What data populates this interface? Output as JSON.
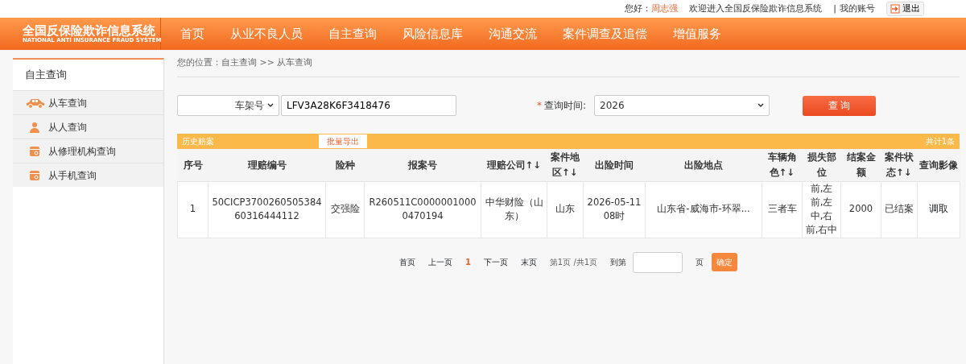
{
  "top_bar": {
    "greeting": "您好：",
    "user": "周志强",
    "welcome": "欢迎进入全国反保险欺诈信息系统",
    "separator": "|",
    "account": "我的账号",
    "logout": "退出"
  },
  "logo": {
    "title": "全国反保险欺诈信息系统",
    "subtitle": "NATIONAL ANTI INSURANCE FRAUD SYSTEM"
  },
  "nav": [
    "首页",
    "从业不良人员",
    "自主查询",
    "风险信息库",
    "沟通交流",
    "案件调查及追偿",
    "增值服务"
  ],
  "sidebar": {
    "title": "自主查询",
    "items": [
      {
        "label": "从车查询",
        "kind": "car"
      },
      {
        "label": "从人查询",
        "kind": "person"
      },
      {
        "label": "从修理机构查询",
        "kind": "doc"
      },
      {
        "label": "从手机查询",
        "kind": "doc"
      }
    ]
  },
  "breadcrumb": "您的位置：自主查询 >> 从车查询",
  "search": {
    "type_select": "车架号",
    "value": "LFV3A28K6F3418476",
    "time_label": "查询时间:",
    "required_mark": "*",
    "time_value": "2026",
    "button": "查 询"
  },
  "table": {
    "title": "历史赔案",
    "export": "批量导出",
    "total": "共计1条",
    "columns": [
      "序号",
      "理赔编号",
      "险种",
      "报案号",
      "理赔公司↑↓",
      "案件地区↑↓",
      "出险时间",
      "出险地点",
      "车辆角色↑↓",
      "损失部位",
      "结案金额",
      "案件状态↑↓",
      "查询影像"
    ],
    "rows": [
      [
        "1",
        "50CICP370026050538460316444112",
        "交强险",
        "R260511C00000010000470194",
        "中华财险（山东）",
        "山东",
        "2026-05-11 08时",
        "山东省-威海市-环翠...",
        "三者车",
        "前,左前,左中,右前,右中",
        "2000",
        "已结案",
        "调取"
      ]
    ]
  },
  "pagination": {
    "first": "首页",
    "prev": "上一页",
    "current": "1",
    "next": "下一页",
    "last": "末页",
    "info": "第1页 /共1页",
    "goto": "到第",
    "page": "页",
    "confirm": "确定"
  }
}
